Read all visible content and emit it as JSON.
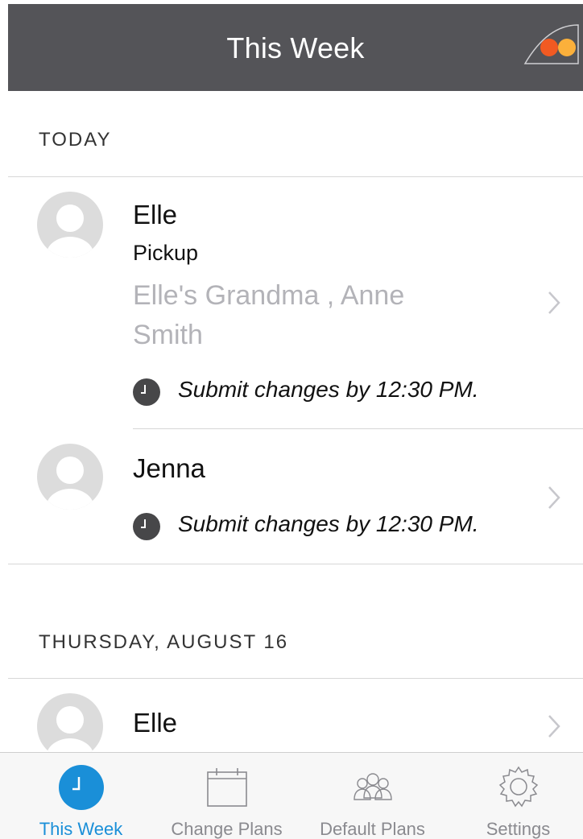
{
  "header": {
    "title": "This Week",
    "logo_icon": "two-dots-brand-logo",
    "bg_color": "#545458"
  },
  "sections": [
    {
      "title": "TODAY",
      "items": [
        {
          "name": "Elle",
          "role": "Pickup",
          "people": "Elle's Grandma , Anne Smith",
          "deadline": "Submit changes by 12:30 PM."
        },
        {
          "name": "Jenna",
          "deadline": "Submit changes by 12:30 PM."
        }
      ]
    },
    {
      "title": "THURSDAY, AUGUST 16",
      "items": [
        {
          "name": "Elle"
        }
      ]
    }
  ],
  "tabs": [
    {
      "label": "This Week",
      "icon": "clock-icon",
      "active": true
    },
    {
      "label": "Change Plans",
      "icon": "calendar-icon",
      "active": false
    },
    {
      "label": "Default Plans",
      "icon": "group-icon",
      "active": false
    },
    {
      "label": "Settings",
      "icon": "gear-icon",
      "active": false
    }
  ],
  "colors": {
    "accent": "#1a8fd8",
    "header": "#545458",
    "secondary_text": "#b3b3b8",
    "logo_red": "#f15a22",
    "logo_orange": "#fbb03b"
  }
}
